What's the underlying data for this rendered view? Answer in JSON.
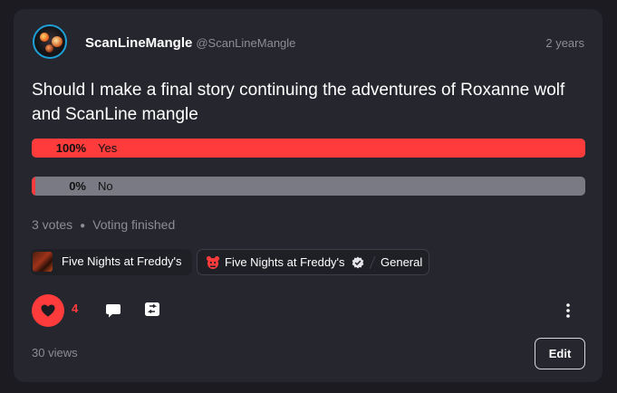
{
  "post": {
    "author": {
      "name": "ScanLineMangle",
      "handle": "@ScanLineMangle"
    },
    "time": "2 years",
    "title": "Should I make a final story continuing the adventures of Roxanne wolf and ScanLine mangle"
  },
  "poll": {
    "options": [
      {
        "label": "Yes",
        "percent_text": "100%",
        "fraction": 1.0
      },
      {
        "label": "No",
        "percent_text": "0%",
        "fraction": 0.0
      }
    ],
    "votes_text": "3 votes",
    "status_text": "Voting finished"
  },
  "tags": [
    {
      "label": "Five Nights at Freddy's",
      "icon": "fnaf-thumbnail-icon"
    },
    {
      "label": "Five Nights at Freddy's",
      "icon": "freddy-bear-icon",
      "badge_icon": "verified-badge-icon",
      "sub_label": "General"
    }
  ],
  "actions": {
    "like_count": "4",
    "views_text": "30 views",
    "edit_label": "Edit"
  },
  "colors": {
    "accent": "#ff3b3b",
    "card_bg": "#26262f",
    "page_bg": "#1b1b21",
    "bar_track": "#7a7a84",
    "muted_text": "#8d8d98"
  }
}
